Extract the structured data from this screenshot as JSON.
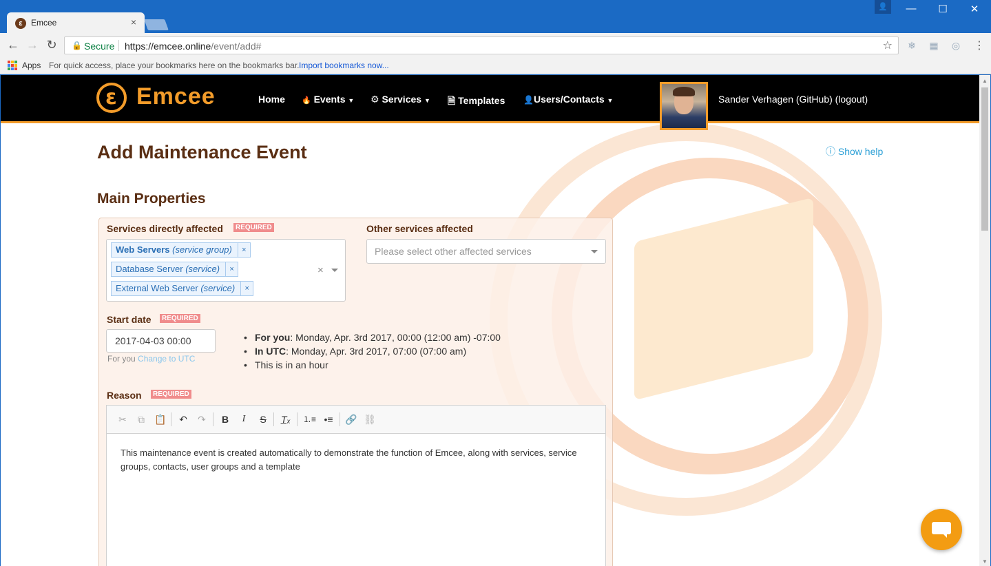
{
  "browser": {
    "tab_title": "Emcee",
    "tab_close": "×",
    "secure_label": "Secure",
    "url_host": "https://emcee.online",
    "url_path": "/event/add#",
    "apps_label": "Apps",
    "bookmarks_hint": "For quick access, place your bookmarks here on the bookmarks bar.",
    "import_bookmarks": "Import bookmarks now..."
  },
  "navbar": {
    "brand": "Emcee",
    "items": [
      {
        "label": "Home",
        "icon": ""
      },
      {
        "label": "Events",
        "icon": "fire-icon",
        "glyph": "🔥"
      },
      {
        "label": "Services",
        "icon": "gear-icon",
        "glyph": "⚙"
      },
      {
        "label": "Templates",
        "icon": "file-icon",
        "glyph": "🗎"
      },
      {
        "label": "Users/Contacts",
        "icon": "user-icon",
        "glyph": "👤"
      }
    ],
    "user": "Sander Verhagen (GitHub) (logout)"
  },
  "page": {
    "title": "Add Maintenance Event",
    "show_help": "Show help",
    "section": "Main Properties"
  },
  "form": {
    "services_label": "Services directly affected",
    "required": "REQUIRED",
    "services": [
      {
        "name": "Web Servers",
        "type": "(service group)"
      },
      {
        "name": "Database Server",
        "type": "(service)"
      },
      {
        "name": "External Web Server",
        "type": "(service)"
      }
    ],
    "other_label": "Other services affected",
    "other_placeholder": "Please select other affected services",
    "start_label": "Start date",
    "start_value": "2017-04-03 00:00",
    "for_you": "For you",
    "change_utc": "Change to UTC",
    "tz": [
      {
        "bold": "For you",
        "text": ": Monday, Apr. 3rd 2017, 00:00 (12:00 am) -07:00"
      },
      {
        "bold": "In UTC",
        "text": ": Monday, Apr. 3rd 2017, 07:00 (07:00 am)"
      },
      {
        "bold": "",
        "text": "This is in an hour"
      }
    ],
    "reason_label": "Reason",
    "reason_text": "This maintenance event is created automatically to demonstrate the function of Emcee, along with services, service groups, contacts, user groups and a template"
  },
  "colors": {
    "brand": "#f39c2a",
    "heading": "#5a2e13",
    "required_badge": "#f08c8c"
  }
}
